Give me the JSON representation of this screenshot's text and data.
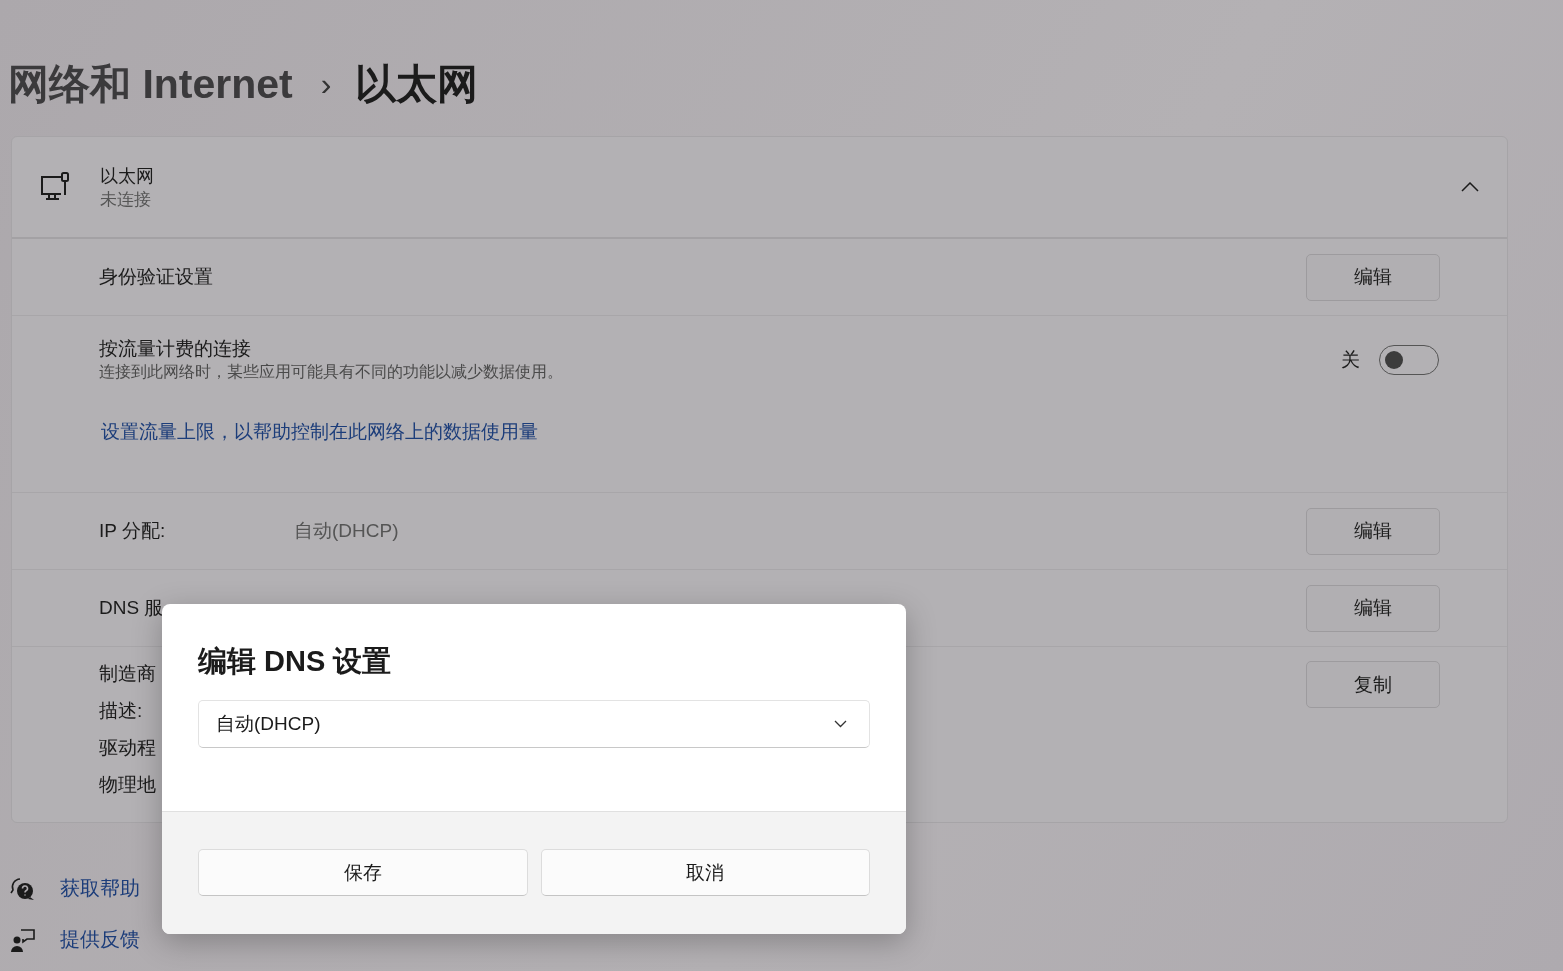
{
  "breadcrumb": {
    "parent": "网络和 Internet",
    "separator": "›",
    "current": "以太网"
  },
  "adapter": {
    "name": "以太网",
    "status": "未连接",
    "expanded": true
  },
  "rows": [
    {
      "kind": "button",
      "label": "身份验证设置",
      "button": "编辑"
    },
    {
      "kind": "toggle",
      "label": "按流量计费的连接",
      "description": "连接到此网络时，某些应用可能具有不同的功能以减少数据使用。",
      "state_label": "关",
      "on": false,
      "link": "设置流量上限，以帮助控制在此网络上的数据使用量"
    },
    {
      "kind": "value",
      "label": "IP 分配:",
      "value": "自动(DHCP)",
      "button": "编辑"
    },
    {
      "kind": "value",
      "label": "DNS 服",
      "button": "编辑"
    },
    {
      "kind": "info",
      "labels": [
        "制造商",
        "描述:",
        "驱动程",
        "物理地"
      ],
      "button": "复制"
    }
  ],
  "links": [
    {
      "kind": "help",
      "label": "获取帮助"
    },
    {
      "kind": "feedback",
      "label": "提供反馈"
    }
  ],
  "dialog": {
    "title": "编辑 DNS 设置",
    "dropdown": {
      "value": "自动(DHCP)"
    },
    "buttons": [
      "保存",
      "取消"
    ]
  }
}
